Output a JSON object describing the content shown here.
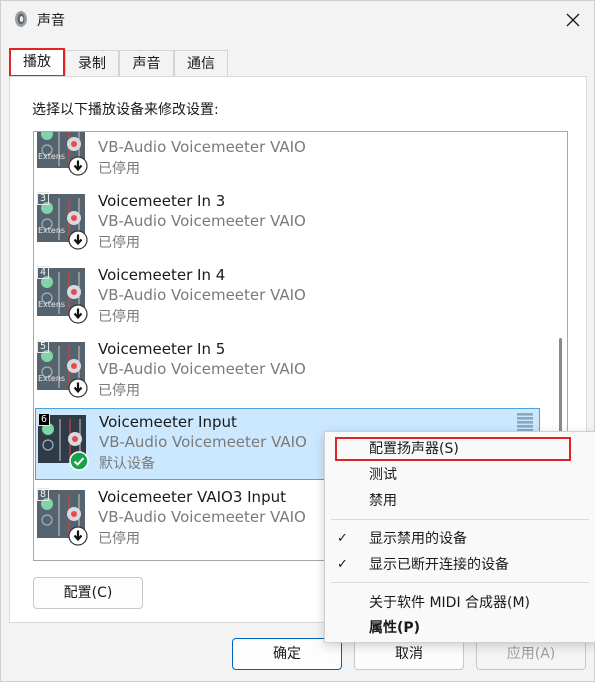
{
  "window": {
    "title": "声音"
  },
  "tabs": [
    {
      "label": "播放"
    },
    {
      "label": "录制"
    },
    {
      "label": "声音"
    },
    {
      "label": "通信"
    }
  ],
  "instruction": "选择以下播放设备来修改设置:",
  "devices": [
    {
      "badge": "",
      "name": "",
      "driver": "VB-Audio Voicemeeter VAIO",
      "status": "已停用",
      "tag": "Extens",
      "state_icon": "down-arrow-icon"
    },
    {
      "badge": "3",
      "name": "Voicemeeter In 3",
      "driver": "VB-Audio Voicemeeter VAIO",
      "status": "已停用",
      "tag": "Extens",
      "state_icon": "down-arrow-icon"
    },
    {
      "badge": "4",
      "name": "Voicemeeter In 4",
      "driver": "VB-Audio Voicemeeter VAIO",
      "status": "已停用",
      "tag": "Extens",
      "state_icon": "down-arrow-icon"
    },
    {
      "badge": "5",
      "name": "Voicemeeter In 5",
      "driver": "VB-Audio Voicemeeter VAIO",
      "status": "已停用",
      "tag": "Extens",
      "state_icon": "down-arrow-icon"
    },
    {
      "badge": "6",
      "name": "Voicemeeter Input",
      "driver": "VB-Audio Voicemeeter VAIO",
      "status": "默认设备",
      "tag": "",
      "state_icon": "green-check-icon",
      "selected": true
    },
    {
      "badge": "8",
      "name": "Voicemeeter VAIO3 Input",
      "driver": "VB-Audio Voicemeeter VAIO",
      "status": "已停用",
      "tag": "",
      "state_icon": "down-arrow-icon"
    }
  ],
  "buttons": {
    "configure": "配置(C)",
    "ok": "确定",
    "cancel": "取消",
    "apply": "应用(A)"
  },
  "context_menu": {
    "items": [
      {
        "label": "配置扬声器(S)",
        "checked": false,
        "highlight": true
      },
      {
        "label": "测试",
        "checked": false
      },
      {
        "label": "禁用",
        "checked": false
      },
      {
        "label": "显示禁用的设备",
        "checked": true
      },
      {
        "label": "显示已断开连接的设备",
        "checked": true
      },
      {
        "label": "关于软件 MIDI 合成器(M)",
        "checked": false
      },
      {
        "label": "属性(P)",
        "checked": false,
        "bold": true
      }
    ],
    "check_glyph": "✓"
  },
  "colors": {
    "highlight_red": "#e02424",
    "selection_bg": "#cce8ff",
    "default_green": "#16a34a"
  }
}
